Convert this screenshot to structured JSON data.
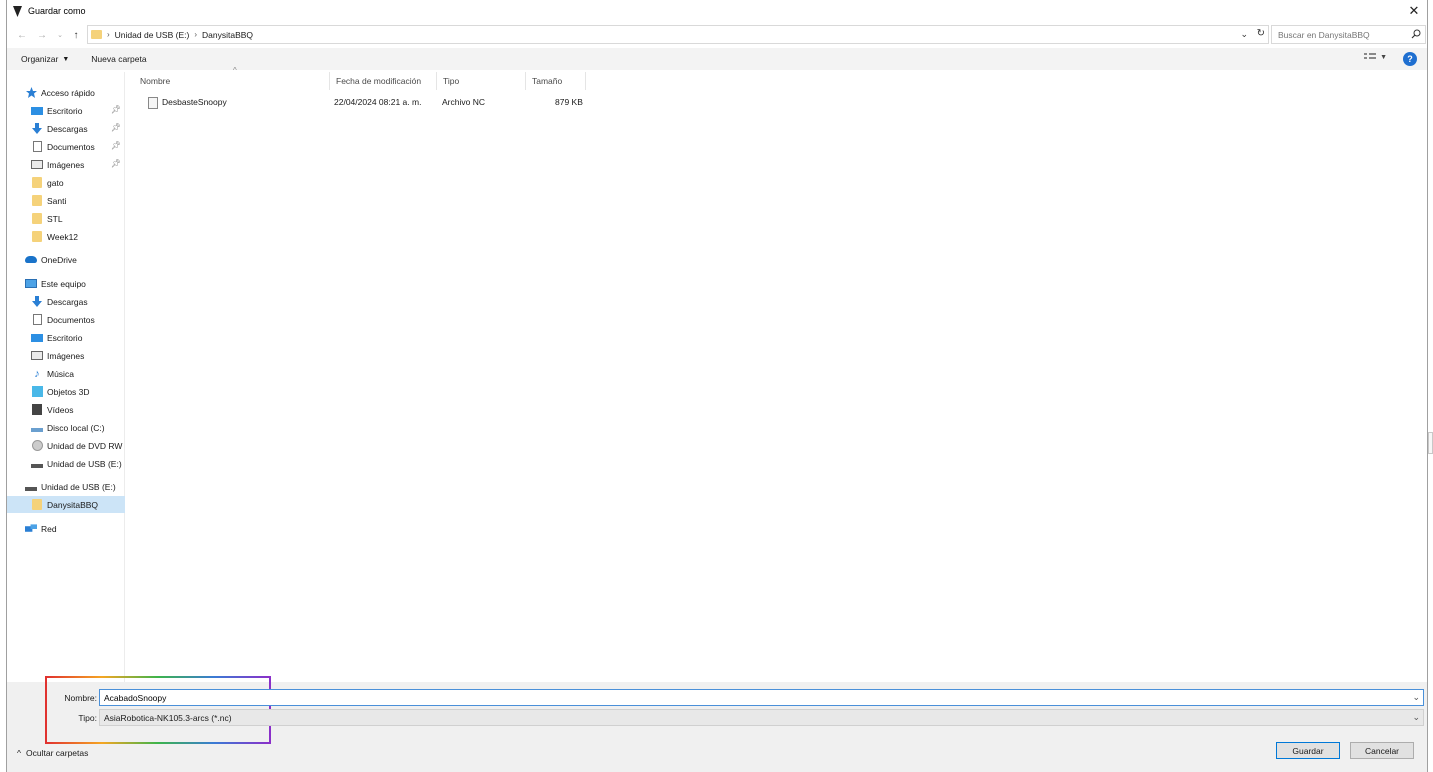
{
  "window": {
    "title": "Guardar como",
    "close_glyph": "✕"
  },
  "address": {
    "crumbs": [
      "Unidad de USB (E:)",
      "DanysitaBBQ"
    ],
    "separator": "›",
    "search_placeholder": "Buscar en DanysitaBBQ"
  },
  "toolbar": {
    "organize_label": "Organizar",
    "new_folder_label": "Nueva carpeta",
    "help_glyph": "?"
  },
  "navpane": {
    "quick_access": "Acceso rápido",
    "quick_items": [
      "Escritorio",
      "Descargas",
      "Documentos",
      "Imágenes",
      "gato",
      "Santi",
      "STL",
      "Week12"
    ],
    "onedrive": "OneDrive",
    "this_pc": "Este equipo",
    "pc_items": [
      "Descargas",
      "Documentos",
      "Escritorio",
      "Imágenes",
      "Música",
      "Objetos 3D",
      "Vídeos",
      "Disco local (C:)",
      "Unidad de DVD RW",
      "Unidad de USB (E:)"
    ],
    "usb": "Unidad de USB (E:)",
    "usb_child": "DanysitaBBQ",
    "network": "Red"
  },
  "columns": {
    "name": "Nombre",
    "date": "Fecha de modificación",
    "type": "Tipo",
    "size": "Tamaño"
  },
  "files": [
    {
      "name": "DesbasteSnoopy",
      "date": "22/04/2024 08:21 a. m.",
      "type": "Archivo NC",
      "size": "879 KB"
    }
  ],
  "form": {
    "name_label": "Nombre:",
    "name_value": "AcabadoSnoopy",
    "type_label": "Tipo:",
    "type_value": "AsiaRobotica-NK105.3-arcs (*.nc)",
    "hide_folders": "Ocultar carpetas",
    "save_button": "Guardar",
    "cancel_button": "Cancelar"
  },
  "colors": {
    "accent": "#0078d7",
    "selection": "#cce4f7",
    "folder": "#f5d27a",
    "highlight_gradient": [
      "#e0312f",
      "#f5a623",
      "#3cb44b",
      "#3a7bd5",
      "#8b2fc9"
    ]
  }
}
